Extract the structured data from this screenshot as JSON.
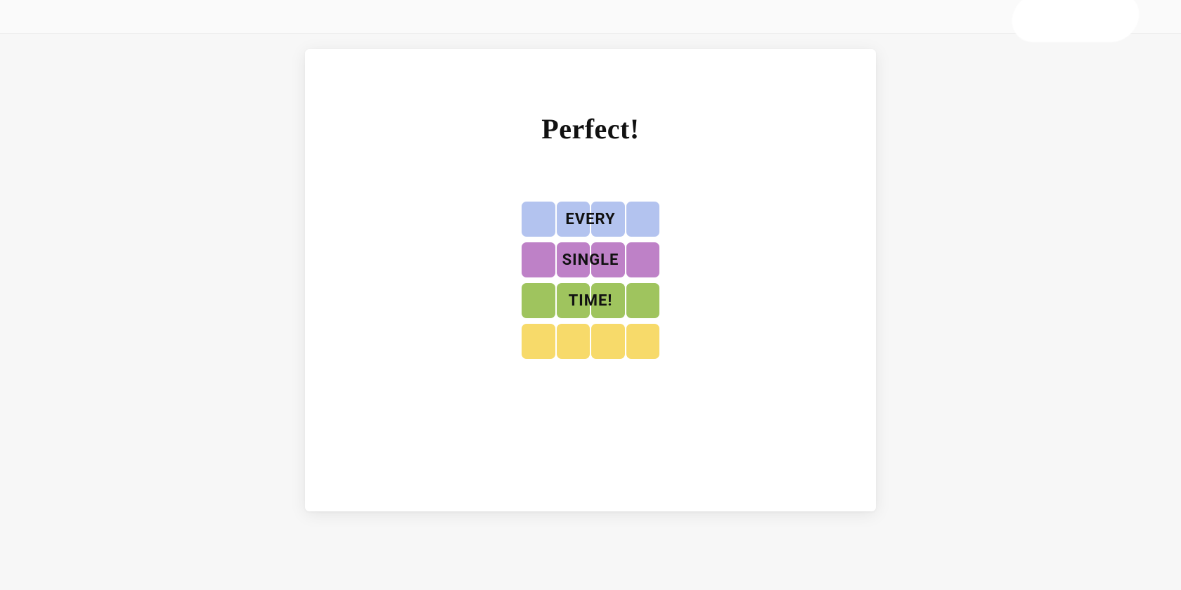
{
  "modal": {
    "headline": "Perfect!",
    "rows": [
      {
        "label": "EVERY",
        "color": "#b3c3ef"
      },
      {
        "label": "SINGLE",
        "color": "#be81c7"
      },
      {
        "label": "TIME!",
        "color": "#9fc45e"
      },
      {
        "label": "",
        "color": "#f7da6a"
      }
    ],
    "tiles_per_row": 4
  }
}
